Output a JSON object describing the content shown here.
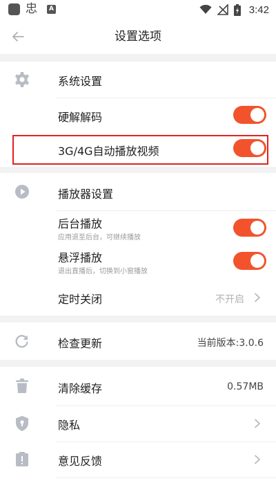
{
  "status_bar": {
    "glyph": "忠",
    "a_badge": "A",
    "time": "3:42"
  },
  "header": {
    "title": "设置选项"
  },
  "sections": {
    "system": {
      "heading": "系统设置",
      "items": [
        {
          "label": "硬解解码",
          "enabled": true
        },
        {
          "label": "3G/4G自动播放视频",
          "enabled": true
        }
      ]
    },
    "player": {
      "heading": "播放器设置",
      "items": [
        {
          "label": "后台播放",
          "sub": "应用退至后台，可继续播放",
          "enabled": true
        },
        {
          "label": "悬浮播放",
          "sub": "退出直播后，切换到小窗播放",
          "enabled": true
        }
      ],
      "timer": {
        "label": "定时关闭",
        "value": "不开启"
      }
    },
    "update": {
      "label": "检查更新",
      "value": "当前版本:3.0.6"
    },
    "misc": {
      "cache": {
        "label": "清除缓存",
        "value": "0.57MB"
      },
      "privacy": {
        "label": "隐私"
      },
      "feedback": {
        "label": "意见反馈"
      }
    }
  },
  "colors": {
    "accent": "#f2532c",
    "highlight_border": "#e02020",
    "icon_gray": "#b8bcc4",
    "section_gap": "#f2f2f2"
  }
}
